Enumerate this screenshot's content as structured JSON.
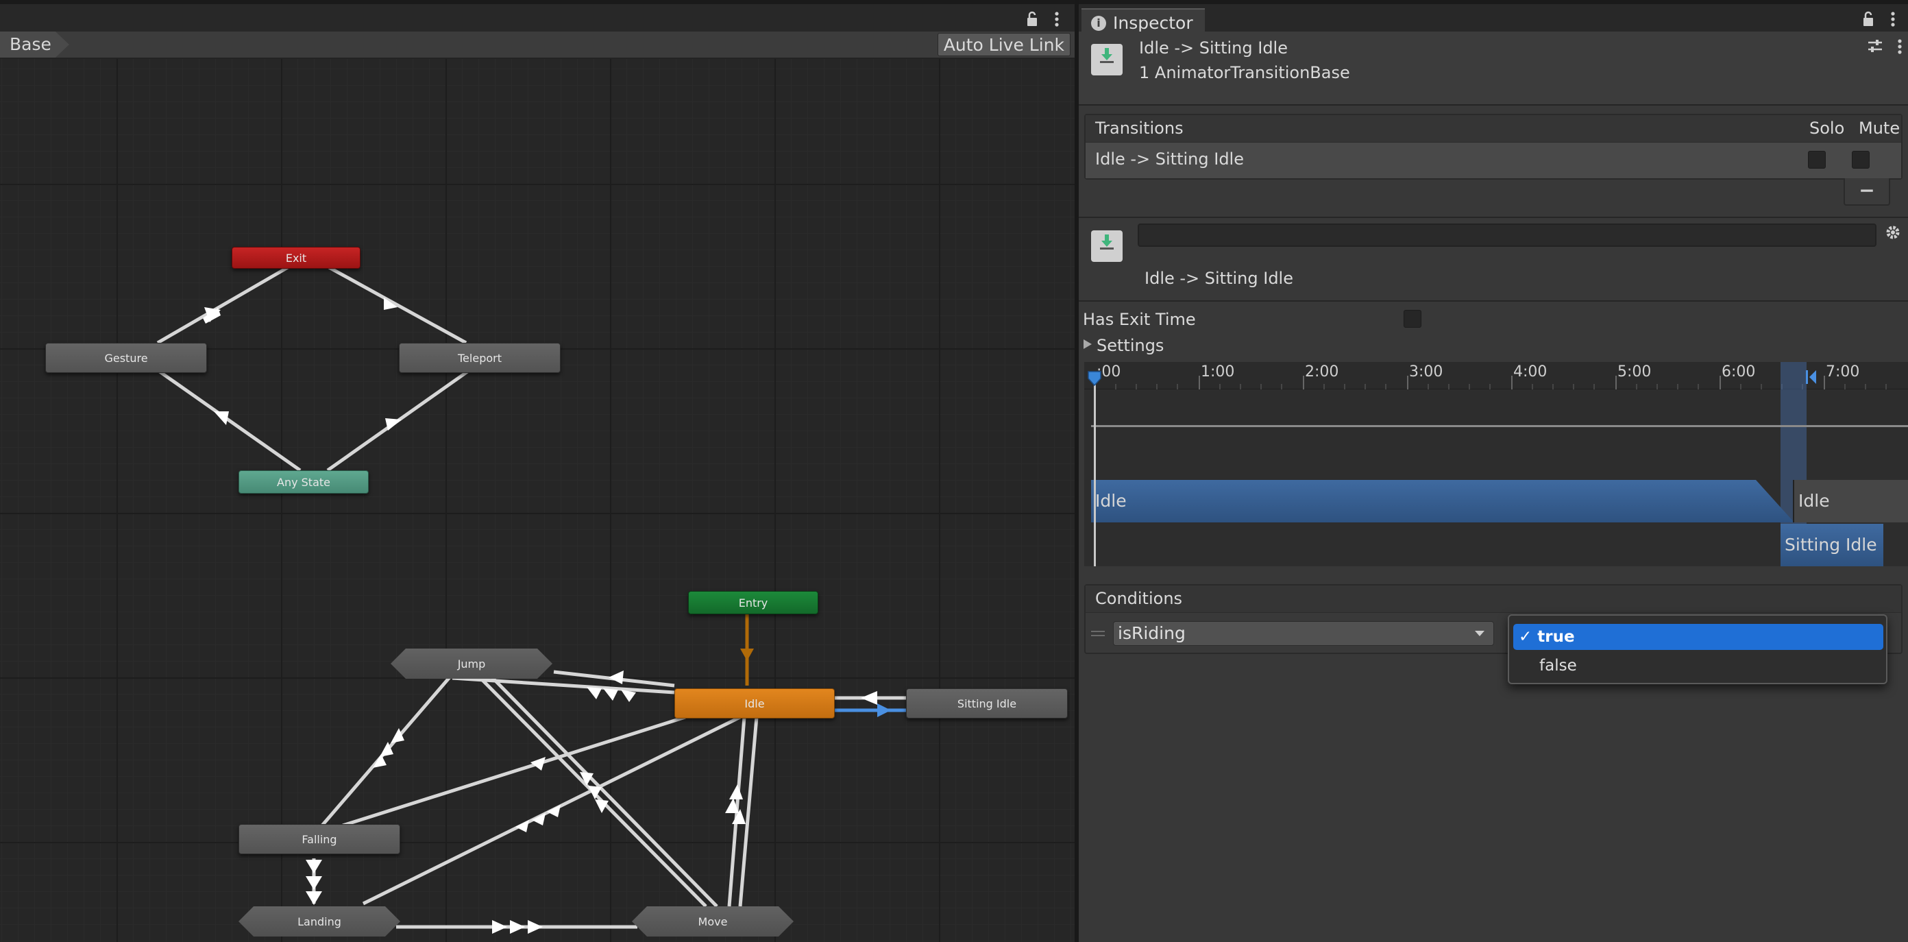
{
  "graph": {
    "breadcrumb": "Base",
    "auto_live_link_label": "Auto Live Link",
    "toolbar_icons": [
      "lock-icon",
      "kebab-menu-icon"
    ],
    "nodes": {
      "exit": "Exit",
      "gesture": "Gesture",
      "teleport": "Teleport",
      "any_state": "Any State",
      "entry": "Entry",
      "jump": "Jump",
      "idle": "Idle",
      "sitting_idle": "Sitting Idle",
      "falling": "Falling",
      "landing": "Landing",
      "move": "Move"
    },
    "colors": {
      "exit": "#b81c1c",
      "any_state": "#54a088",
      "entry": "#187a32",
      "idle_default": "#d77a16",
      "selected_transition": "#4a90e2"
    }
  },
  "inspector": {
    "tab_label": "Inspector",
    "header_title": "Idle -> Sitting Idle",
    "header_subtitle": "1 AnimatorTransitionBase",
    "transitions": {
      "header": "Transitions",
      "solo_label": "Solo",
      "mute_label": "Mute",
      "row_label": "Idle -> Sitting Idle",
      "remove_label": "−"
    },
    "preview": {
      "name_value": "",
      "label": "Idle -> Sitting Idle"
    },
    "has_exit_time_label": "Has Exit Time",
    "settings_label": "Settings",
    "timeline": {
      "ticks": [
        ":00",
        "1:00",
        "2:00",
        "3:00",
        "4:00",
        "5:00",
        "6:00",
        "7:00"
      ],
      "source_state": "Idle",
      "destination_state": "Sitting Idle",
      "next_state": "Idle"
    },
    "conditions": {
      "header": "Conditions",
      "parameter": "isRiding",
      "dropdown_options": [
        {
          "label": "true",
          "selected": true
        },
        {
          "label": "false",
          "selected": false
        }
      ]
    }
  }
}
